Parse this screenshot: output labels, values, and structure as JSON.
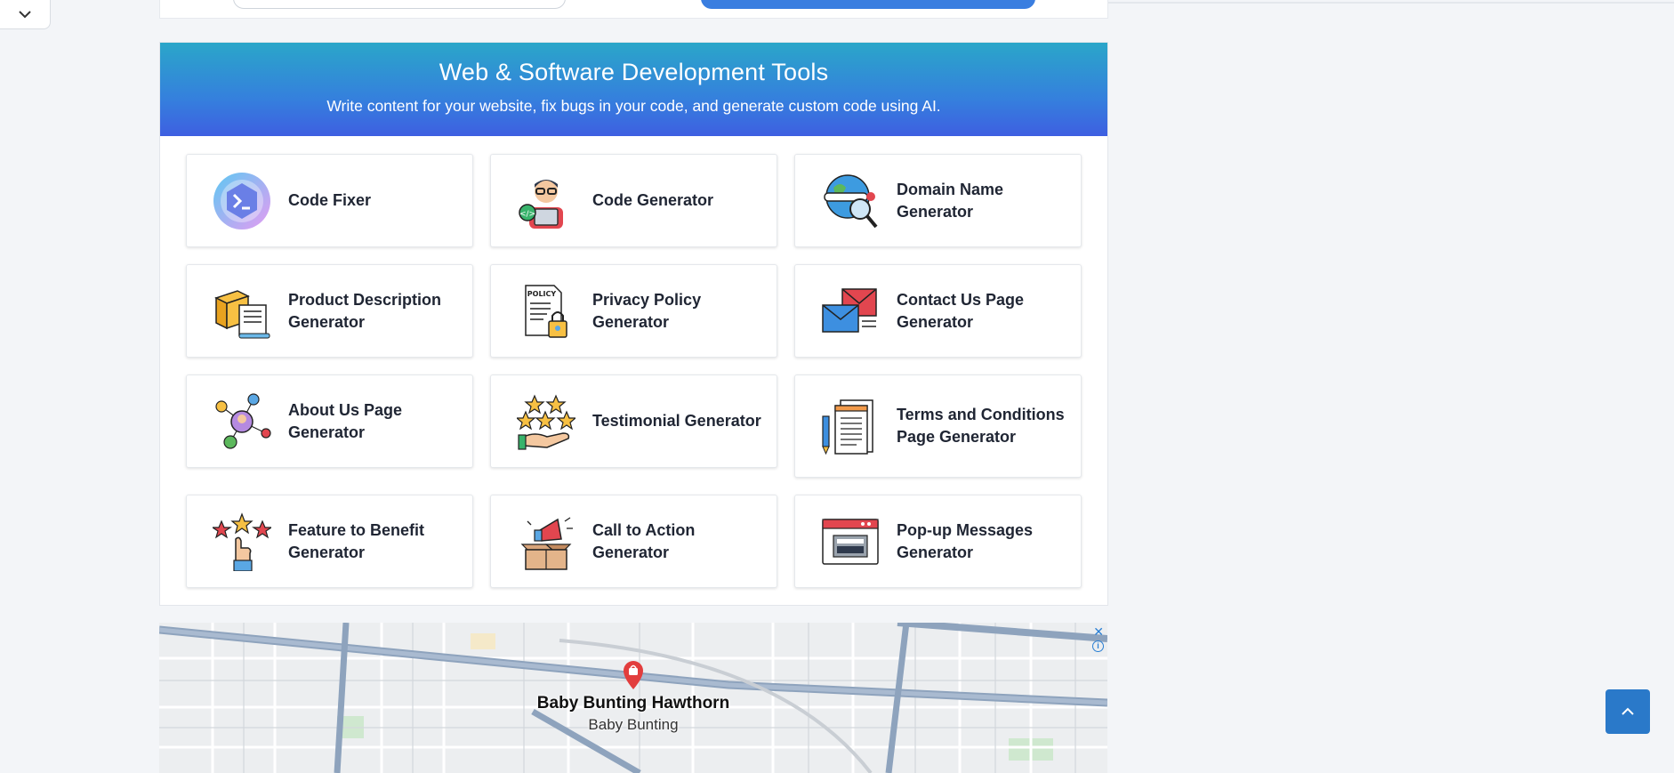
{
  "section": {
    "title": "Web & Software Development Tools",
    "subtitle": "Write content for your website, fix bugs in your code, and generate custom code using AI."
  },
  "tools": [
    {
      "label": "Code Fixer",
      "icon": "code-fixer-icon"
    },
    {
      "label": "Code Generator",
      "icon": "developer-icon"
    },
    {
      "label": "Domain Name Generator",
      "icon": "globe-search-icon"
    },
    {
      "label": "Product Description Generator",
      "icon": "box-document-icon"
    },
    {
      "label": "Privacy Policy Generator",
      "icon": "policy-lock-icon"
    },
    {
      "label": "Contact Us Page Generator",
      "icon": "envelopes-icon"
    },
    {
      "label": "About Us Page Generator",
      "icon": "people-network-icon"
    },
    {
      "label": "Testimonial Generator",
      "icon": "stars-hand-icon"
    },
    {
      "label": "Terms and Conditions Page Generator",
      "icon": "terms-document-icon"
    },
    {
      "label": "Feature to Benefit Generator",
      "icon": "thumbs-up-stars-icon"
    },
    {
      "label": "Call to Action Generator",
      "icon": "megaphone-box-icon"
    },
    {
      "label": "Pop-up Messages Generator",
      "icon": "popup-window-icon"
    }
  ],
  "ad": {
    "store_name": "Baby Bunting Hawthorn",
    "store_brand": "Baby Bunting",
    "close_glyph": "✕",
    "info_glyph": "i"
  },
  "colors": {
    "banner_top": "#2aa6c9",
    "banner_bottom": "#3e5fe1",
    "scroll_top_button": "#2a79c9"
  }
}
